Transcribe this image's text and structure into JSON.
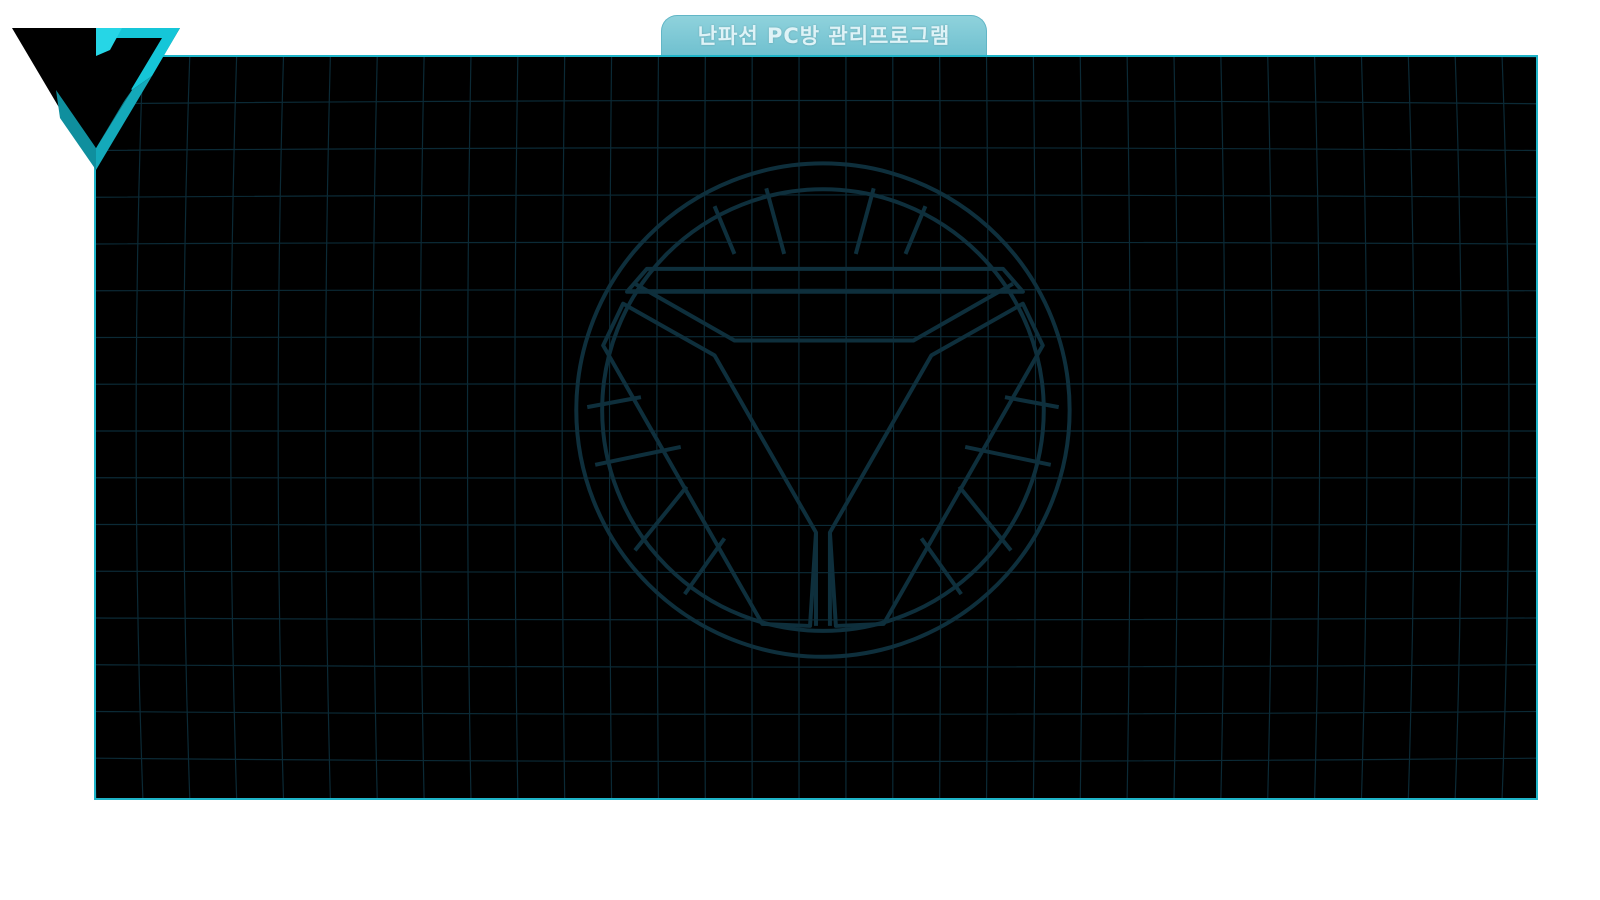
{
  "window": {
    "title": "난파선 PC방 관리프로그램"
  },
  "icons": {
    "logo": "v-triangle-logo-icon",
    "watermark": "arc-reactor-icon"
  },
  "colors": {
    "accent": "#1fb4c8",
    "tab_fill": "#7ccad6",
    "panel_bg": "#000000",
    "grid_line": "#0b2a36",
    "watermark_line": "#0e2f3c"
  }
}
